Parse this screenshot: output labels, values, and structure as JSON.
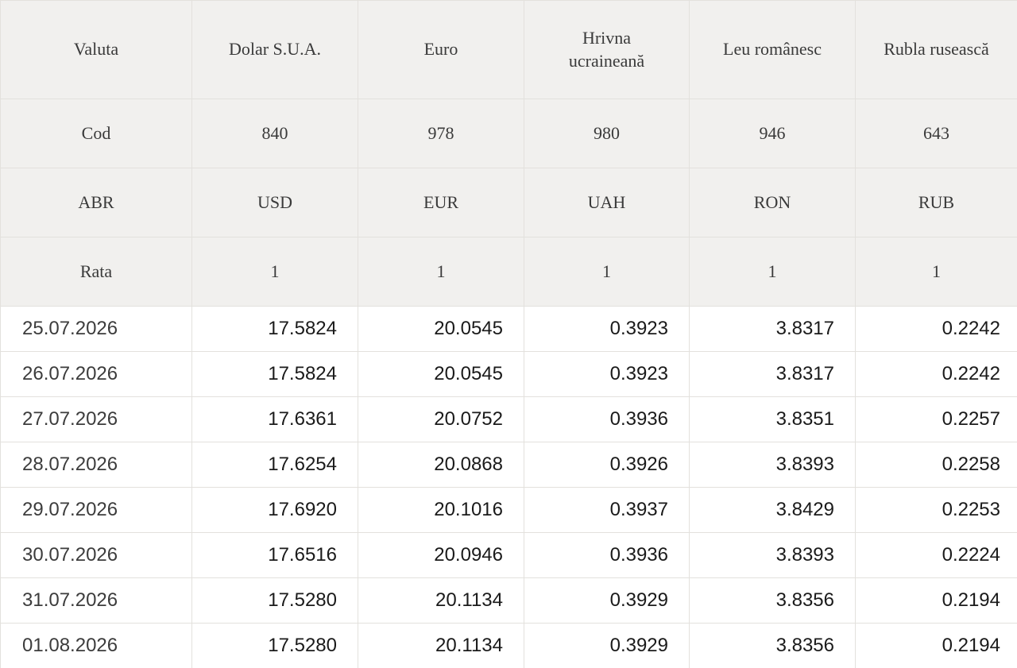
{
  "table": {
    "header_rows": [
      {
        "key": "currency",
        "label": "Valuta",
        "values": [
          "Dolar S.U.A.",
          "Euro",
          "Hrivna ucraineană",
          "Leu românesc",
          "Rubla rusească"
        ]
      },
      {
        "key": "cod",
        "label": "Cod",
        "values": [
          "840",
          "978",
          "980",
          "946",
          "643"
        ]
      },
      {
        "key": "abr",
        "label": "ABR",
        "values": [
          "USD",
          "EUR",
          "UAH",
          "RON",
          "RUB"
        ]
      },
      {
        "key": "rata",
        "label": "Rata",
        "values": [
          "1",
          "1",
          "1",
          "1",
          "1"
        ]
      }
    ],
    "rows": [
      {
        "date": "25.07.2026",
        "values": [
          "17.5824",
          "20.0545",
          "0.3923",
          "3.8317",
          "0.2242"
        ]
      },
      {
        "date": "26.07.2026",
        "values": [
          "17.5824",
          "20.0545",
          "0.3923",
          "3.8317",
          "0.2242"
        ]
      },
      {
        "date": "27.07.2026",
        "values": [
          "17.6361",
          "20.0752",
          "0.3936",
          "3.8351",
          "0.2257"
        ]
      },
      {
        "date": "28.07.2026",
        "values": [
          "17.6254",
          "20.0868",
          "0.3926",
          "3.8393",
          "0.2258"
        ]
      },
      {
        "date": "29.07.2026",
        "values": [
          "17.6920",
          "20.1016",
          "0.3937",
          "3.8429",
          "0.2253"
        ]
      },
      {
        "date": "30.07.2026",
        "values": [
          "17.6516",
          "20.0946",
          "0.3936",
          "3.8393",
          "0.2224"
        ]
      },
      {
        "date": "31.07.2026",
        "values": [
          "17.5280",
          "20.1134",
          "0.3929",
          "3.8356",
          "0.2194"
        ]
      },
      {
        "date": "01.08.2026",
        "values": [
          "17.5280",
          "20.1134",
          "0.3929",
          "3.8356",
          "0.2194"
        ]
      }
    ]
  },
  "colors": {
    "header_background": "#f1f0ee",
    "border": "#e3e1dd",
    "text": "#1a1a1a"
  }
}
